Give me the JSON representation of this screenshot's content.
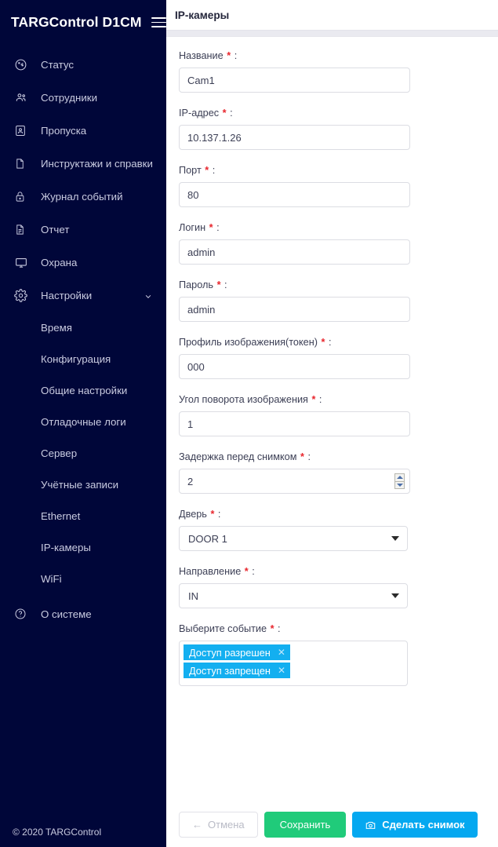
{
  "sidebar": {
    "brand": "TARGControl D1CM",
    "menu_icon": "hamburger-icon",
    "items": [
      {
        "label": "Статус",
        "icon": "gauge-icon"
      },
      {
        "label": "Сотрудники",
        "icon": "users-icon"
      },
      {
        "label": "Пропуска",
        "icon": "id-badge-icon"
      },
      {
        "label": "Инструктажи и справки",
        "icon": "document-icon"
      },
      {
        "label": "Журнал событий",
        "icon": "lock-icon"
      },
      {
        "label": "Отчет",
        "icon": "report-icon"
      },
      {
        "label": "Охрана",
        "icon": "monitor-icon"
      },
      {
        "label": "Настройки",
        "icon": "gear-icon",
        "expanded": true,
        "chevron": "chevron-down-icon"
      }
    ],
    "settings_subitems": [
      {
        "label": "Время"
      },
      {
        "label": "Конфигурация"
      },
      {
        "label": "Общие настройки"
      },
      {
        "label": "Отладочные логи"
      },
      {
        "label": "Сервер"
      },
      {
        "label": "Учётные записи"
      },
      {
        "label": "Ethernet"
      },
      {
        "label": "IP-камеры"
      },
      {
        "label": "WiFi"
      }
    ],
    "about": {
      "label": "О системе",
      "icon": "question-circle-icon"
    },
    "copyright": "© 2020 TARGControl"
  },
  "header": {
    "title": "IP-камеры"
  },
  "form": {
    "required_mark": "*",
    "colon": ":",
    "fields": [
      {
        "label": "Название",
        "value": "Cam1",
        "type": "text"
      },
      {
        "label": "IP-адрес",
        "value": "10.137.1.26",
        "type": "text"
      },
      {
        "label": "Порт",
        "value": "80",
        "type": "text"
      },
      {
        "label": "Логин",
        "value": "admin",
        "type": "text"
      },
      {
        "label": "Пароль",
        "value": "admin",
        "type": "text"
      },
      {
        "label": "Профиль изображения(токен)",
        "value": "000",
        "type": "text"
      },
      {
        "label": "Угол поворота изображения",
        "value": "1",
        "type": "text"
      },
      {
        "label": "Задержка перед снимком",
        "value": "2",
        "type": "number"
      }
    ],
    "door": {
      "label": "Дверь",
      "value": "DOOR 1"
    },
    "direction": {
      "label": "Направление",
      "value": "IN"
    },
    "events": {
      "label": "Выберите событие",
      "tags": [
        "Доступ разрешен",
        "Доступ запрещен"
      ],
      "remove_glyph": "✕"
    }
  },
  "footer": {
    "cancel": "Отмена",
    "cancel_arrow": "←",
    "save": "Сохранить",
    "snapshot": "Сделать снимок",
    "snapshot_icon": "camera-icon"
  },
  "colors": {
    "sidebar_bg": "#000639",
    "accent_blue": "#05a8f0",
    "save_green": "#20cb7a",
    "tag_blue": "#13aff0",
    "required_red": "#e8262d"
  }
}
